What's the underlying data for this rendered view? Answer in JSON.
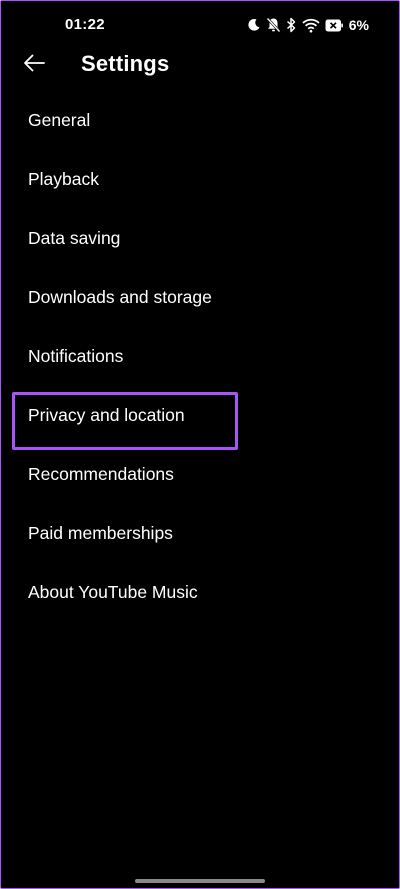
{
  "status_bar": {
    "time": "01:22",
    "battery_percent": "6%",
    "icons": [
      "moon-icon",
      "bell-off-icon",
      "bluetooth-icon",
      "wifi-icon",
      "battery-icon"
    ]
  },
  "app_bar": {
    "back_icon": "arrow-left-icon",
    "title": "Settings"
  },
  "settings": {
    "items": [
      {
        "label": "General"
      },
      {
        "label": "Playback"
      },
      {
        "label": "Data saving"
      },
      {
        "label": "Downloads and storage"
      },
      {
        "label": "Notifications"
      },
      {
        "label": "Privacy and location"
      },
      {
        "label": "Recommendations"
      },
      {
        "label": "Paid memberships"
      },
      {
        "label": "About YouTube Music"
      }
    ]
  },
  "highlight": {
    "target": "Privacy and location",
    "color": "#a855f7"
  },
  "colors": {
    "background": "#000000",
    "text": "#ffffff",
    "accent": "#a855f7"
  }
}
